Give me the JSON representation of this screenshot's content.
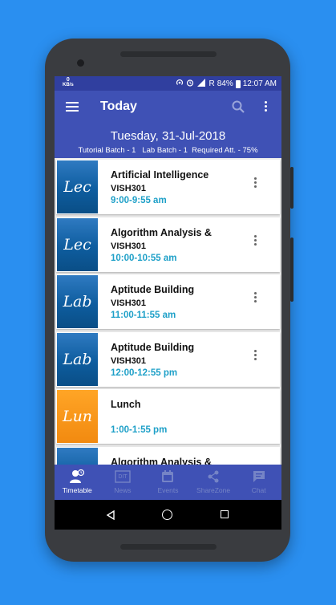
{
  "status": {
    "speed_value": "0",
    "speed_unit": "KB/s",
    "carrier": "R",
    "battery": "84%",
    "time": "12:07 AM"
  },
  "appbar": {
    "title": "Today",
    "icons": [
      "menu-icon",
      "search-icon",
      "more-vert-icon"
    ]
  },
  "header": {
    "date": "Tuesday, 31-Jul-2018",
    "batch_line": "Tutorial Batch - 1   Lab Batch - 1  Required Att. - 75%"
  },
  "sessions": [
    {
      "badge": "Lec",
      "type": "lec",
      "title": "Artificial Intelligence",
      "room": "VISH301",
      "time": "9:00-9:55 am"
    },
    {
      "badge": "Lec",
      "type": "lec",
      "title": "Algorithm Analysis &",
      "room": "VISH301",
      "time": "10:00-10:55 am"
    },
    {
      "badge": "Lab",
      "type": "lab",
      "title": "Aptitude Building",
      "room": "VISH301",
      "time": "11:00-11:55 am"
    },
    {
      "badge": "Lab",
      "type": "lab",
      "title": "Aptitude Building",
      "room": "VISH301",
      "time": "12:00-12:55 pm"
    },
    {
      "badge": "Lun",
      "type": "lun",
      "title": "Lunch",
      "room": "",
      "time": "1:00-1:55 pm"
    },
    {
      "badge": "",
      "type": "lec",
      "title": "Algorithm Analysis &",
      "room": "",
      "time": ""
    }
  ],
  "bottom_nav": [
    {
      "label": "Timetable",
      "icon": "timetable-icon",
      "active": true
    },
    {
      "label": "News",
      "icon": "news-icon",
      "active": false
    },
    {
      "label": "Events",
      "icon": "calendar-icon",
      "active": false
    },
    {
      "label": "ShareZone",
      "icon": "share-icon",
      "active": false
    },
    {
      "label": "Chat",
      "icon": "chat-icon",
      "active": false
    }
  ],
  "colors": {
    "appbar": "#3f51b5",
    "statusbar": "#303f9f",
    "time_text": "#1ea0c8",
    "lecture_badge": "#0e5d9f",
    "lunch_badge": "#f28a10",
    "background": "#2a8ff0"
  }
}
